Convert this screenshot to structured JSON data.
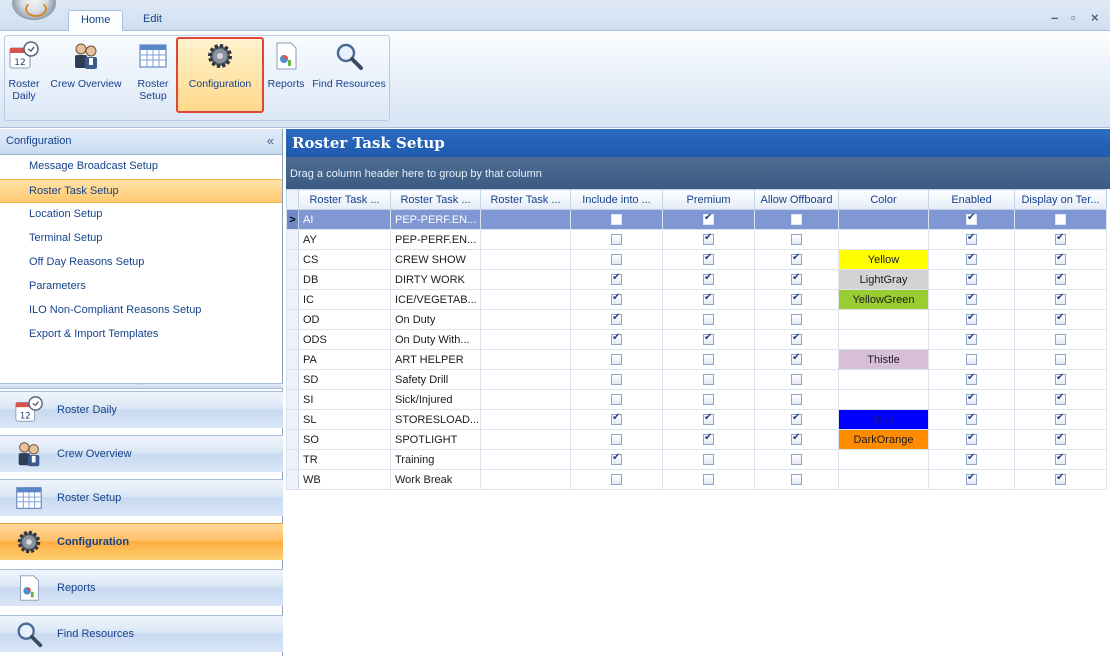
{
  "tabs": [
    {
      "label": "Home",
      "active": true
    },
    {
      "label": "Edit",
      "active": false
    }
  ],
  "window_controls": {
    "minimize": "–",
    "restore": "▫",
    "close": "×"
  },
  "ribbon": {
    "buttons": [
      {
        "label": "Roster Daily",
        "line1": "Roster",
        "line2": "Daily",
        "icon": "calendar-clock-icon"
      },
      {
        "label": "Crew Overview",
        "line1": "Crew Overview",
        "line2": "",
        "icon": "crew-icon"
      },
      {
        "label": "Roster Setup",
        "line1": "Roster",
        "line2": "Setup",
        "icon": "grid-icon"
      },
      {
        "label": "Configuration",
        "line1": "Configuration",
        "line2": "",
        "icon": "gear-icon",
        "selected": true
      },
      {
        "label": "Reports",
        "line1": "Reports",
        "line2": "",
        "icon": "report-icon"
      },
      {
        "label": "Find Resources",
        "line1": "Find Resources",
        "line2": "",
        "icon": "magnifier-icon"
      }
    ]
  },
  "nav": {
    "header": "Configuration",
    "collapse_glyph": "«",
    "items": [
      {
        "label": "Message Broadcast Setup"
      },
      {
        "label": "Roster Task Setup",
        "active": true
      },
      {
        "label": "Location Setup"
      },
      {
        "label": "Terminal Setup"
      },
      {
        "label": "Off Day Reasons Setup"
      },
      {
        "label": "Parameters"
      },
      {
        "label": "ILO Non-Compliant Reasons Setup"
      },
      {
        "label": "Export & Import Templates"
      }
    ],
    "splitter_glyph": "·····",
    "buttons": [
      {
        "label": "Roster Daily",
        "icon": "calendar-clock-icon"
      },
      {
        "label": "Crew Overview",
        "icon": "crew-icon"
      },
      {
        "label": "Roster Setup",
        "icon": "grid-icon"
      },
      {
        "label": "Configuration",
        "icon": "gear-icon",
        "active": true
      },
      {
        "label": "Reports",
        "icon": "report-icon"
      },
      {
        "label": "Find Resources",
        "icon": "magnifier-icon"
      }
    ]
  },
  "content": {
    "title": "Roster Task Setup",
    "group_hint": "Drag a column header here to group by that column",
    "row_indicator": ">",
    "columns": [
      "Roster Task ...",
      "Roster Task ...",
      "Roster Task ...",
      "Include into ...",
      "Premium",
      "Allow Offboard",
      "Color",
      "Enabled",
      "Display on Ter..."
    ],
    "rows": [
      {
        "code": "AI",
        "name": "PEP-PERF.EN...",
        "extra": "",
        "include": false,
        "premium": true,
        "offboard": false,
        "color": "",
        "color_hex": "",
        "enabled": true,
        "display": false,
        "selected": true
      },
      {
        "code": "AY",
        "name": "PEP-PERF.EN...",
        "extra": "",
        "include": false,
        "premium": true,
        "offboard": false,
        "color": "",
        "color_hex": "",
        "enabled": true,
        "display": true
      },
      {
        "code": "CS",
        "name": "CREW SHOW",
        "extra": "",
        "include": false,
        "premium": true,
        "offboard": true,
        "color": "Yellow",
        "color_hex": "#ffff00",
        "enabled": true,
        "display": true
      },
      {
        "code": "DB",
        "name": "DIRTY WORK",
        "extra": "",
        "include": true,
        "premium": true,
        "offboard": true,
        "color": "LightGray",
        "color_hex": "#d3d3d3",
        "enabled": true,
        "display": true
      },
      {
        "code": "IC",
        "name": "ICE/VEGETAB...",
        "extra": "",
        "include": true,
        "premium": true,
        "offboard": true,
        "color": "YellowGreen",
        "color_hex": "#9acd32",
        "enabled": true,
        "display": true
      },
      {
        "code": "OD",
        "name": "On Duty",
        "extra": "",
        "include": true,
        "premium": false,
        "offboard": false,
        "color": "",
        "color_hex": "",
        "enabled": true,
        "display": true
      },
      {
        "code": "ODS",
        "name": "On Duty With...",
        "extra": "",
        "include": true,
        "premium": true,
        "offboard": true,
        "color": "",
        "color_hex": "",
        "enabled": true,
        "display": false
      },
      {
        "code": "PA",
        "name": "ART HELPER",
        "extra": "",
        "include": false,
        "premium": false,
        "offboard": true,
        "color": "Thistle",
        "color_hex": "#d8bfd8",
        "enabled": false,
        "display": false
      },
      {
        "code": "SD",
        "name": "Safety Drill",
        "extra": "",
        "include": false,
        "premium": false,
        "offboard": false,
        "color": "",
        "color_hex": "",
        "enabled": true,
        "display": true
      },
      {
        "code": "SI",
        "name": "Sick/Injured",
        "extra": "",
        "include": false,
        "premium": false,
        "offboard": false,
        "color": "",
        "color_hex": "",
        "enabled": true,
        "display": true
      },
      {
        "code": "SL",
        "name": "STORESLOAD...",
        "extra": "",
        "include": true,
        "premium": true,
        "offboard": true,
        "color": "Blue",
        "color_hex": "#0000ff",
        "enabled": true,
        "display": true
      },
      {
        "code": "SO",
        "name": "SPOTLIGHT",
        "extra": "",
        "include": false,
        "premium": true,
        "offboard": true,
        "color": "DarkOrange",
        "color_hex": "#ff8c00",
        "enabled": true,
        "display": true
      },
      {
        "code": "TR",
        "name": "Training",
        "extra": "",
        "include": true,
        "premium": false,
        "offboard": false,
        "color": "",
        "color_hex": "",
        "enabled": true,
        "display": true
      },
      {
        "code": "WB",
        "name": "Work Break",
        "extra": "",
        "include": false,
        "premium": false,
        "offboard": false,
        "color": "",
        "color_hex": "",
        "enabled": true,
        "display": true
      }
    ]
  }
}
